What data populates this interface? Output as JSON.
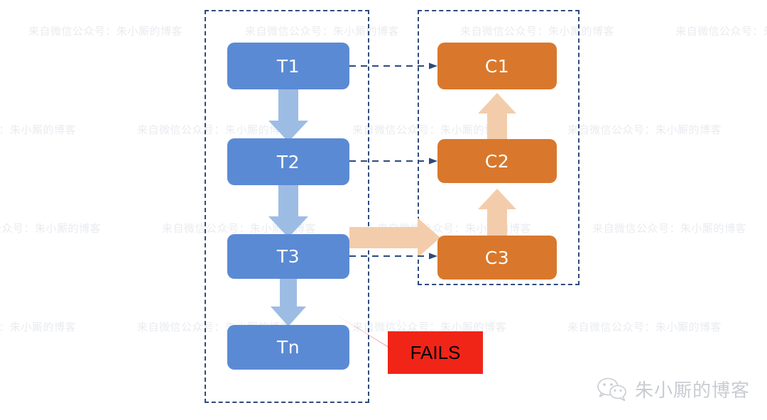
{
  "diagram": {
    "title": "Transaction and compensation flow with failure callout",
    "colors": {
      "node_blue": "#5b8ad5",
      "node_orange": "#d9782c",
      "arrow_blue": "#9dbce4",
      "arrow_peach": "#f3cdab",
      "group_border": "#2e4a7d",
      "callout_red": "#f02518",
      "watermark": "#e9ebef"
    },
    "left_group": {
      "name": "transaction-group",
      "nodes": [
        {
          "id": "T1",
          "label": "T1"
        },
        {
          "id": "T2",
          "label": "T2"
        },
        {
          "id": "T3",
          "label": "T3"
        },
        {
          "id": "Tn",
          "label": "Tn"
        }
      ]
    },
    "right_group": {
      "name": "compensation-group",
      "nodes": [
        {
          "id": "C1",
          "label": "C1"
        },
        {
          "id": "C2",
          "label": "C2"
        },
        {
          "id": "C3",
          "label": "C3"
        }
      ]
    },
    "callout": {
      "label": "FAILS"
    }
  },
  "watermark": {
    "text": "来自微信公众号：朱小厮的博客"
  },
  "brand": {
    "icon": "wechat-icon",
    "text": "朱小厮的博客"
  }
}
